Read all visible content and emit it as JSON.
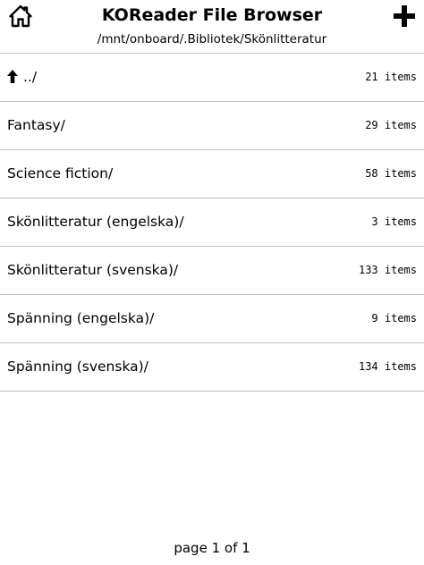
{
  "header": {
    "title": "KOReader File Browser",
    "path": "/mnt/onboard/.Bibliotek/Skönlitteratur",
    "left_icon": "home-icon",
    "right_icon": "plus-icon"
  },
  "list": {
    "items": [
      {
        "name": "../",
        "count": "21 items",
        "icon": "up-arrow-icon"
      },
      {
        "name": "Fantasy/",
        "count": "29 items"
      },
      {
        "name": "Science fiction/",
        "count": "58 items"
      },
      {
        "name": "Skönlitteratur (engelska)/",
        "count": "3 items"
      },
      {
        "name": "Skönlitteratur (svenska)/",
        "count": "133 items"
      },
      {
        "name": "Spänning (engelska)/",
        "count": "9 items"
      },
      {
        "name": "Spänning (svenska)/",
        "count": "134 items"
      }
    ]
  },
  "footer": {
    "page_label": "page 1 of 1"
  },
  "colors": {
    "text": "#000000",
    "background": "#ffffff",
    "divider": "#bdbdbd"
  }
}
